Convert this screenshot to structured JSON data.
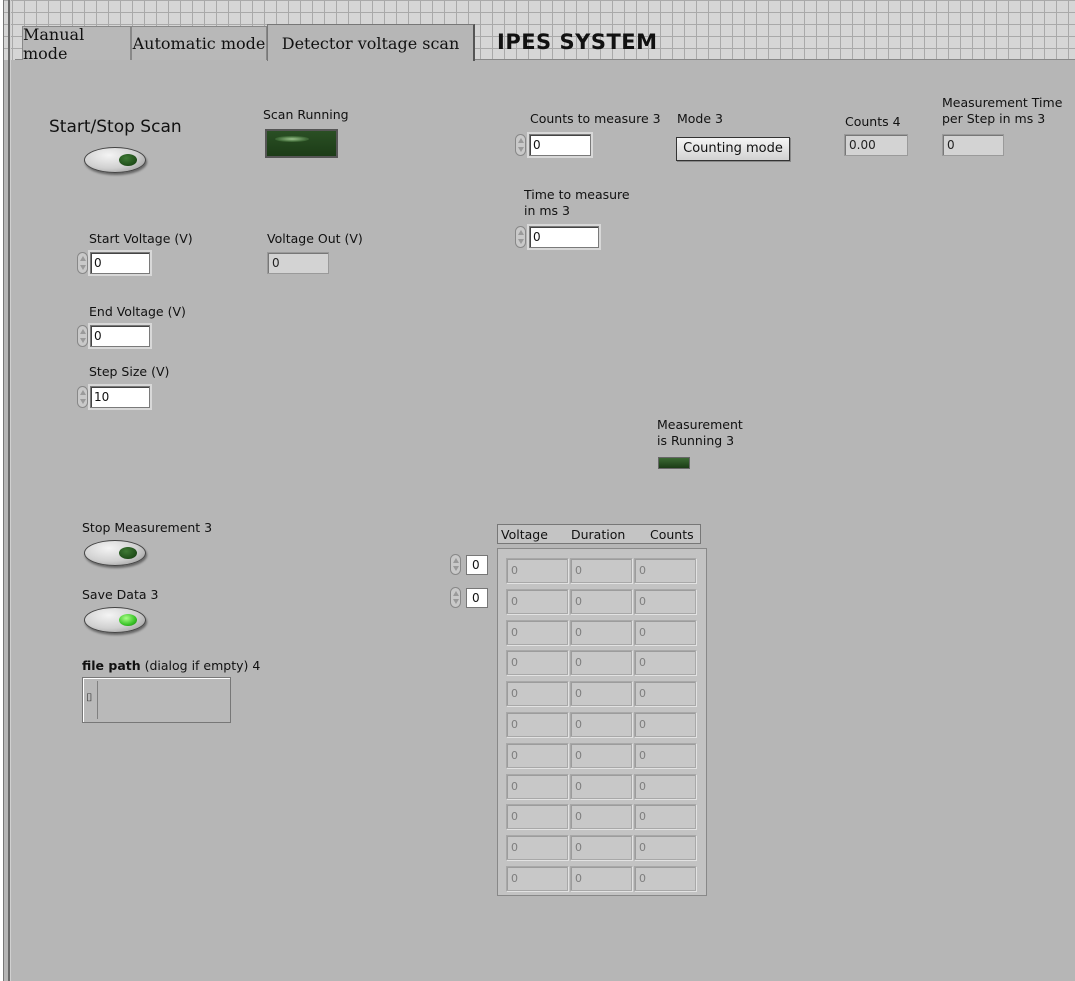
{
  "tabs": [
    {
      "label": "Manual mode"
    },
    {
      "label": "Automatic mode"
    },
    {
      "label": "Detector voltage scan"
    }
  ],
  "system_title": "IPES SYSTEM",
  "scan": {
    "start_stop_label": "Start/Stop Scan",
    "running_label": "Scan Running",
    "start_voltage": {
      "label": "Start Voltage (V)",
      "value": "0"
    },
    "voltage_out": {
      "label": "Voltage Out (V)",
      "value": "0"
    },
    "end_voltage": {
      "label": "End Voltage (V)",
      "value": "0"
    },
    "step_size": {
      "label": "Step Size (V)",
      "value": "10"
    }
  },
  "measure": {
    "counts_to_measure": {
      "label": "Counts to measure 3",
      "value": "0"
    },
    "mode": {
      "label": "Mode 3",
      "value": "Counting mode"
    },
    "counts4": {
      "label": "Counts 4",
      "value": "0.00"
    },
    "meas_time": {
      "label_line1": "Measurement Time",
      "label_line2": "per Step in ms 3",
      "value": "0"
    },
    "time_to_measure": {
      "label_line1": "Time to measure",
      "label_line2": "in ms 3",
      "value": "0"
    },
    "running": {
      "label_line1": "Measurement",
      "label_line2": "is Running 3"
    }
  },
  "controls": {
    "stop_measurement_label": "Stop Measurement 3",
    "save_data_label": "Save Data 3",
    "file_path_bold": "file path",
    "file_path_rest": " (dialog if empty) 4",
    "file_path_icon": "path-icon"
  },
  "table": {
    "columns": [
      "Voltage",
      "Duration",
      "Counts"
    ],
    "index_row": "0",
    "index_col": "0",
    "rows": [
      [
        "0",
        "0",
        "0"
      ],
      [
        "0",
        "0",
        "0"
      ],
      [
        "0",
        "0",
        "0"
      ],
      [
        "0",
        "0",
        "0"
      ],
      [
        "0",
        "0",
        "0"
      ],
      [
        "0",
        "0",
        "0"
      ],
      [
        "0",
        "0",
        "0"
      ],
      [
        "0",
        "0",
        "0"
      ],
      [
        "0",
        "0",
        "0"
      ],
      [
        "0",
        "0",
        "0"
      ],
      [
        "0",
        "0",
        "0"
      ]
    ]
  },
  "colors": {
    "panel": "#b6b6b6",
    "led_off": "#1f4d19",
    "led_on": "#39c227"
  }
}
